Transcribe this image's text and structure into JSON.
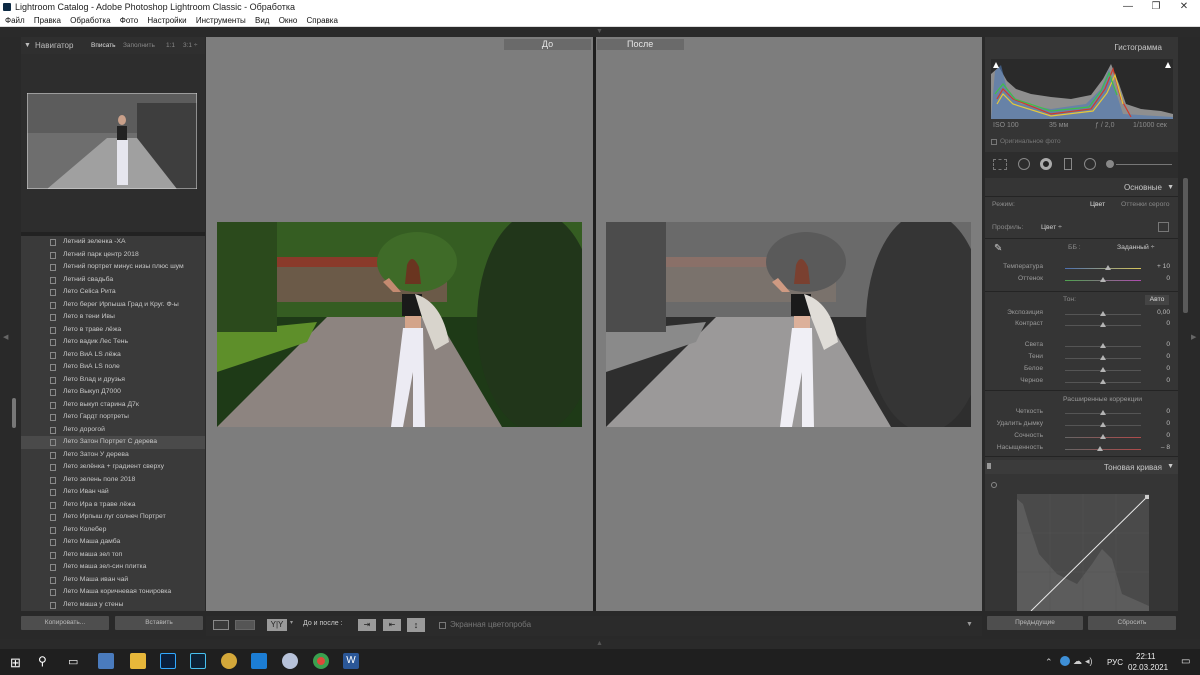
{
  "window": {
    "title": "Lightroom Catalog - Adobe Photoshop Lightroom Classic - Обработка"
  },
  "menu": [
    "Файл",
    "Правка",
    "Обработка",
    "Фото",
    "Настройки",
    "Инструменты",
    "Вид",
    "Окно",
    "Справка"
  ],
  "navigator": {
    "title": "Навигатор",
    "fit": "Вписать",
    "fill": "Заполнить",
    "r1": "1:1",
    "r3": "3:1 ÷"
  },
  "presets": [
    "Летний зеленка -XA",
    "Летний парк центр 2018",
    "Летний портрет минус низы плюс шум",
    "Летний свадьба",
    "Лето Celica Рита",
    "Лето берег Ирпыша Град и Круг. Ф-ы",
    "Лето в тени Ивы",
    "Лето в траве лёжа",
    "Лето вадик Лес Тень",
    "Лето ВиА LS лёжа",
    "Лето ВиА LS поле",
    "Лето Влад и друзья",
    "Лето Выкуп Д7000",
    "Лето выкуп старина Д7к",
    "Лето Гардт портреты",
    "Лето дорогой",
    "Лето Затон Портрет С дерева",
    "Лето Затон У дерева",
    "Лето зелёнка + градиент сверху",
    "Лето зелень поле 2018",
    "Лето Иван чай",
    "Лето Ира в траве лёжа",
    "Лето Ирпыш луг солнеч Портрет",
    "Лето Колебер",
    "Лето Маша дамба",
    "Лето маша зел топ",
    "Лето маша зел-син плитка",
    "Лето Маша иван чай",
    "Лето Маша коричневая тонировка",
    "Лето маша у стены"
  ],
  "left_buttons": {
    "copy": "Копировать...",
    "paste": "Вставить"
  },
  "compare": {
    "before": "До",
    "after": "После"
  },
  "toolbar": {
    "before_after": "До и после :",
    "softproof": "Экранная цветопроба",
    "yy": "Y|Y"
  },
  "histogram": {
    "title": "Гистограмма",
    "iso": "ISO 100",
    "focal": "35 мм",
    "aperture": "ƒ / 2,0",
    "shutter": "1/1000 сек",
    "original": "Оригинальное фото"
  },
  "basic": {
    "title": "Основные",
    "mode_label": "Режим:",
    "mode_color": "Цвет",
    "mode_bw": "Оттенки серого",
    "profile_label": "Профиль:",
    "profile_value": "Цвет ÷",
    "wb_label": "ББ :",
    "wb_value": "Заданный ÷",
    "tone_label": "Тон:",
    "auto": "Авто",
    "presence": "Расширенные коррекции",
    "sliders": [
      {
        "label": "Температура",
        "value": "+ 10",
        "pos": 0.56
      },
      {
        "label": "Оттенок",
        "value": "0",
        "pos": 0.5
      },
      {
        "label": "Экспозиция",
        "value": "0,00",
        "pos": 0.5
      },
      {
        "label": "Контраст",
        "value": "0",
        "pos": 0.5
      },
      {
        "label": "Света",
        "value": "0",
        "pos": 0.5
      },
      {
        "label": "Тени",
        "value": "0",
        "pos": 0.5
      },
      {
        "label": "Белое",
        "value": "0",
        "pos": 0.5
      },
      {
        "label": "Черное",
        "value": "0",
        "pos": 0.5
      },
      {
        "label": "Четкость",
        "value": "0",
        "pos": 0.5
      },
      {
        "label": "Удалить дымку",
        "value": "0",
        "pos": 0.5
      },
      {
        "label": "Сочность",
        "value": "0",
        "pos": 0.5
      },
      {
        "label": "Насыщенность",
        "value": "– 8",
        "pos": 0.46
      }
    ]
  },
  "tonecurve": {
    "title": "Тоновая кривая"
  },
  "right_buttons": {
    "prev": "Предыдущие",
    "reset": "Сбросить"
  },
  "taskbar": {
    "lang": "РУС",
    "time": "22:11",
    "date": "02.03.2021"
  },
  "colors": {
    "panel": "#333333",
    "center": "#7d7d7d",
    "taskbar": "#1f1f1f"
  }
}
